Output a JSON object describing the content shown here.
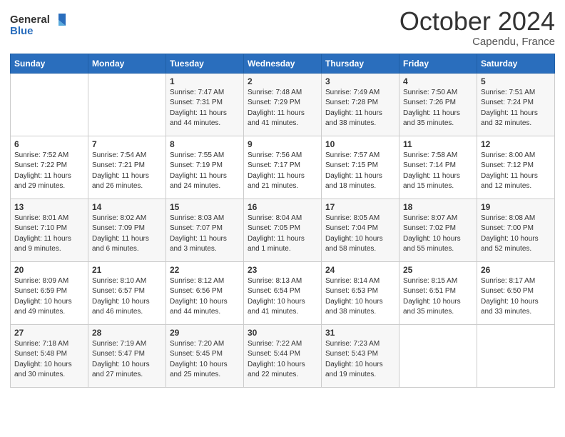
{
  "logo": {
    "text_general": "General",
    "text_blue": "Blue"
  },
  "header": {
    "month": "October 2024",
    "location": "Capendu, France"
  },
  "days_of_week": [
    "Sunday",
    "Monday",
    "Tuesday",
    "Wednesday",
    "Thursday",
    "Friday",
    "Saturday"
  ],
  "weeks": [
    [
      {
        "day": "",
        "sunrise": "",
        "sunset": "",
        "daylight": ""
      },
      {
        "day": "",
        "sunrise": "",
        "sunset": "",
        "daylight": ""
      },
      {
        "day": "1",
        "sunrise": "Sunrise: 7:47 AM",
        "sunset": "Sunset: 7:31 PM",
        "daylight": "Daylight: 11 hours and 44 minutes."
      },
      {
        "day": "2",
        "sunrise": "Sunrise: 7:48 AM",
        "sunset": "Sunset: 7:29 PM",
        "daylight": "Daylight: 11 hours and 41 minutes."
      },
      {
        "day": "3",
        "sunrise": "Sunrise: 7:49 AM",
        "sunset": "Sunset: 7:28 PM",
        "daylight": "Daylight: 11 hours and 38 minutes."
      },
      {
        "day": "4",
        "sunrise": "Sunrise: 7:50 AM",
        "sunset": "Sunset: 7:26 PM",
        "daylight": "Daylight: 11 hours and 35 minutes."
      },
      {
        "day": "5",
        "sunrise": "Sunrise: 7:51 AM",
        "sunset": "Sunset: 7:24 PM",
        "daylight": "Daylight: 11 hours and 32 minutes."
      }
    ],
    [
      {
        "day": "6",
        "sunrise": "Sunrise: 7:52 AM",
        "sunset": "Sunset: 7:22 PM",
        "daylight": "Daylight: 11 hours and 29 minutes."
      },
      {
        "day": "7",
        "sunrise": "Sunrise: 7:54 AM",
        "sunset": "Sunset: 7:21 PM",
        "daylight": "Daylight: 11 hours and 26 minutes."
      },
      {
        "day": "8",
        "sunrise": "Sunrise: 7:55 AM",
        "sunset": "Sunset: 7:19 PM",
        "daylight": "Daylight: 11 hours and 24 minutes."
      },
      {
        "day": "9",
        "sunrise": "Sunrise: 7:56 AM",
        "sunset": "Sunset: 7:17 PM",
        "daylight": "Daylight: 11 hours and 21 minutes."
      },
      {
        "day": "10",
        "sunrise": "Sunrise: 7:57 AM",
        "sunset": "Sunset: 7:15 PM",
        "daylight": "Daylight: 11 hours and 18 minutes."
      },
      {
        "day": "11",
        "sunrise": "Sunrise: 7:58 AM",
        "sunset": "Sunset: 7:14 PM",
        "daylight": "Daylight: 11 hours and 15 minutes."
      },
      {
        "day": "12",
        "sunrise": "Sunrise: 8:00 AM",
        "sunset": "Sunset: 7:12 PM",
        "daylight": "Daylight: 11 hours and 12 minutes."
      }
    ],
    [
      {
        "day": "13",
        "sunrise": "Sunrise: 8:01 AM",
        "sunset": "Sunset: 7:10 PM",
        "daylight": "Daylight: 11 hours and 9 minutes."
      },
      {
        "day": "14",
        "sunrise": "Sunrise: 8:02 AM",
        "sunset": "Sunset: 7:09 PM",
        "daylight": "Daylight: 11 hours and 6 minutes."
      },
      {
        "day": "15",
        "sunrise": "Sunrise: 8:03 AM",
        "sunset": "Sunset: 7:07 PM",
        "daylight": "Daylight: 11 hours and 3 minutes."
      },
      {
        "day": "16",
        "sunrise": "Sunrise: 8:04 AM",
        "sunset": "Sunset: 7:05 PM",
        "daylight": "Daylight: 11 hours and 1 minute."
      },
      {
        "day": "17",
        "sunrise": "Sunrise: 8:05 AM",
        "sunset": "Sunset: 7:04 PM",
        "daylight": "Daylight: 10 hours and 58 minutes."
      },
      {
        "day": "18",
        "sunrise": "Sunrise: 8:07 AM",
        "sunset": "Sunset: 7:02 PM",
        "daylight": "Daylight: 10 hours and 55 minutes."
      },
      {
        "day": "19",
        "sunrise": "Sunrise: 8:08 AM",
        "sunset": "Sunset: 7:00 PM",
        "daylight": "Daylight: 10 hours and 52 minutes."
      }
    ],
    [
      {
        "day": "20",
        "sunrise": "Sunrise: 8:09 AM",
        "sunset": "Sunset: 6:59 PM",
        "daylight": "Daylight: 10 hours and 49 minutes."
      },
      {
        "day": "21",
        "sunrise": "Sunrise: 8:10 AM",
        "sunset": "Sunset: 6:57 PM",
        "daylight": "Daylight: 10 hours and 46 minutes."
      },
      {
        "day": "22",
        "sunrise": "Sunrise: 8:12 AM",
        "sunset": "Sunset: 6:56 PM",
        "daylight": "Daylight: 10 hours and 44 minutes."
      },
      {
        "day": "23",
        "sunrise": "Sunrise: 8:13 AM",
        "sunset": "Sunset: 6:54 PM",
        "daylight": "Daylight: 10 hours and 41 minutes."
      },
      {
        "day": "24",
        "sunrise": "Sunrise: 8:14 AM",
        "sunset": "Sunset: 6:53 PM",
        "daylight": "Daylight: 10 hours and 38 minutes."
      },
      {
        "day": "25",
        "sunrise": "Sunrise: 8:15 AM",
        "sunset": "Sunset: 6:51 PM",
        "daylight": "Daylight: 10 hours and 35 minutes."
      },
      {
        "day": "26",
        "sunrise": "Sunrise: 8:17 AM",
        "sunset": "Sunset: 6:50 PM",
        "daylight": "Daylight: 10 hours and 33 minutes."
      }
    ],
    [
      {
        "day": "27",
        "sunrise": "Sunrise: 7:18 AM",
        "sunset": "Sunset: 5:48 PM",
        "daylight": "Daylight: 10 hours and 30 minutes."
      },
      {
        "day": "28",
        "sunrise": "Sunrise: 7:19 AM",
        "sunset": "Sunset: 5:47 PM",
        "daylight": "Daylight: 10 hours and 27 minutes."
      },
      {
        "day": "29",
        "sunrise": "Sunrise: 7:20 AM",
        "sunset": "Sunset: 5:45 PM",
        "daylight": "Daylight: 10 hours and 25 minutes."
      },
      {
        "day": "30",
        "sunrise": "Sunrise: 7:22 AM",
        "sunset": "Sunset: 5:44 PM",
        "daylight": "Daylight: 10 hours and 22 minutes."
      },
      {
        "day": "31",
        "sunrise": "Sunrise: 7:23 AM",
        "sunset": "Sunset: 5:43 PM",
        "daylight": "Daylight: 10 hours and 19 minutes."
      },
      {
        "day": "",
        "sunrise": "",
        "sunset": "",
        "daylight": ""
      },
      {
        "day": "",
        "sunrise": "",
        "sunset": "",
        "daylight": ""
      }
    ]
  ]
}
